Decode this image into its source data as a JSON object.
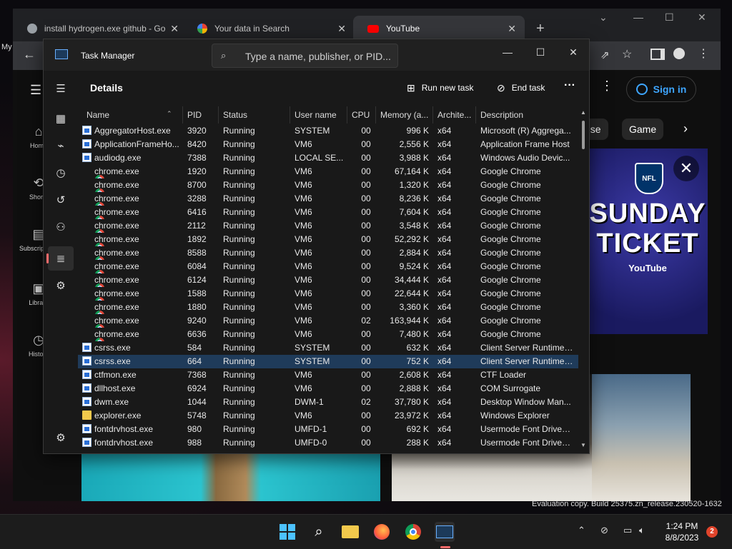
{
  "browser": {
    "tabs": [
      {
        "title": "install hydrogen.exe github - Go",
        "icon": "globe-icon"
      },
      {
        "title": "Your data in Search",
        "icon": "google-icon"
      },
      {
        "title": "YouTube",
        "icon": "youtube-icon"
      }
    ],
    "new_tab": "+",
    "left_overlay": "My"
  },
  "youtube": {
    "sign_in": "Sign in",
    "sidebar": [
      "Home",
      "Shorts",
      "Subscriptions",
      "Library",
      "History"
    ],
    "chips": [
      "use",
      "Game"
    ],
    "ad": {
      "brand": "NFL",
      "headline_1": "SUNDAY",
      "headline_2": "TICKET",
      "partner": "YouTube"
    }
  },
  "task_manager": {
    "window_title": "Task Manager",
    "search_placeholder": "Type a name, publisher, or PID...",
    "page_title": "Details",
    "run_new_task": "Run new task",
    "end_task": "End task",
    "columns": [
      "Name",
      "PID",
      "Status",
      "User name",
      "CPU",
      "Memory (a...",
      "Archite...",
      "Description"
    ],
    "rows": [
      {
        "name": "AggregatorHost.exe",
        "icon": "win",
        "pid": "3920",
        "status": "Running",
        "user": "SYSTEM",
        "cpu": "00",
        "mem": "996 K",
        "arch": "x64",
        "desc": "Microsoft (R) Aggrega..."
      },
      {
        "name": "ApplicationFrameHo...",
        "icon": "win",
        "pid": "8420",
        "status": "Running",
        "user": "VM6",
        "cpu": "00",
        "mem": "2,556 K",
        "arch": "x64",
        "desc": "Application Frame Host"
      },
      {
        "name": "audiodg.exe",
        "icon": "win",
        "pid": "7388",
        "status": "Running",
        "user": "LOCAL SE...",
        "cpu": "00",
        "mem": "3,988 K",
        "arch": "x64",
        "desc": "Windows Audio Devic..."
      },
      {
        "name": "chrome.exe",
        "icon": "chrome",
        "pid": "1920",
        "status": "Running",
        "user": "VM6",
        "cpu": "00",
        "mem": "67,164 K",
        "arch": "x64",
        "desc": "Google Chrome"
      },
      {
        "name": "chrome.exe",
        "icon": "chrome",
        "pid": "8700",
        "status": "Running",
        "user": "VM6",
        "cpu": "00",
        "mem": "1,320 K",
        "arch": "x64",
        "desc": "Google Chrome"
      },
      {
        "name": "chrome.exe",
        "icon": "chrome",
        "pid": "3288",
        "status": "Running",
        "user": "VM6",
        "cpu": "00",
        "mem": "8,236 K",
        "arch": "x64",
        "desc": "Google Chrome"
      },
      {
        "name": "chrome.exe",
        "icon": "chrome",
        "pid": "6416",
        "status": "Running",
        "user": "VM6",
        "cpu": "00",
        "mem": "7,604 K",
        "arch": "x64",
        "desc": "Google Chrome"
      },
      {
        "name": "chrome.exe",
        "icon": "chrome",
        "pid": "2112",
        "status": "Running",
        "user": "VM6",
        "cpu": "00",
        "mem": "3,548 K",
        "arch": "x64",
        "desc": "Google Chrome"
      },
      {
        "name": "chrome.exe",
        "icon": "chrome",
        "pid": "1892",
        "status": "Running",
        "user": "VM6",
        "cpu": "00",
        "mem": "52,292 K",
        "arch": "x64",
        "desc": "Google Chrome"
      },
      {
        "name": "chrome.exe",
        "icon": "chrome",
        "pid": "8588",
        "status": "Running",
        "user": "VM6",
        "cpu": "00",
        "mem": "2,884 K",
        "arch": "x64",
        "desc": "Google Chrome"
      },
      {
        "name": "chrome.exe",
        "icon": "chrome",
        "pid": "6084",
        "status": "Running",
        "user": "VM6",
        "cpu": "00",
        "mem": "9,524 K",
        "arch": "x64",
        "desc": "Google Chrome"
      },
      {
        "name": "chrome.exe",
        "icon": "chrome",
        "pid": "6124",
        "status": "Running",
        "user": "VM6",
        "cpu": "00",
        "mem": "34,444 K",
        "arch": "x64",
        "desc": "Google Chrome"
      },
      {
        "name": "chrome.exe",
        "icon": "chrome",
        "pid": "1588",
        "status": "Running",
        "user": "VM6",
        "cpu": "00",
        "mem": "22,644 K",
        "arch": "x64",
        "desc": "Google Chrome"
      },
      {
        "name": "chrome.exe",
        "icon": "chrome",
        "pid": "1880",
        "status": "Running",
        "user": "VM6",
        "cpu": "00",
        "mem": "3,360 K",
        "arch": "x64",
        "desc": "Google Chrome"
      },
      {
        "name": "chrome.exe",
        "icon": "chrome",
        "pid": "9240",
        "status": "Running",
        "user": "VM6",
        "cpu": "02",
        "mem": "163,944 K",
        "arch": "x64",
        "desc": "Google Chrome"
      },
      {
        "name": "chrome.exe",
        "icon": "chrome",
        "pid": "6636",
        "status": "Running",
        "user": "VM6",
        "cpu": "00",
        "mem": "7,480 K",
        "arch": "x64",
        "desc": "Google Chrome"
      },
      {
        "name": "csrss.exe",
        "icon": "win",
        "pid": "584",
        "status": "Running",
        "user": "SYSTEM",
        "cpu": "00",
        "mem": "632 K",
        "arch": "x64",
        "desc": "Client Server Runtime ..."
      },
      {
        "name": "csrss.exe",
        "icon": "win",
        "pid": "664",
        "status": "Running",
        "user": "SYSTEM",
        "cpu": "00",
        "mem": "752 K",
        "arch": "x64",
        "desc": "Client Server Runtime ...",
        "selected": true
      },
      {
        "name": "ctfmon.exe",
        "icon": "win",
        "pid": "7368",
        "status": "Running",
        "user": "VM6",
        "cpu": "00",
        "mem": "2,608 K",
        "arch": "x64",
        "desc": "CTF Loader"
      },
      {
        "name": "dllhost.exe",
        "icon": "win",
        "pid": "6924",
        "status": "Running",
        "user": "VM6",
        "cpu": "00",
        "mem": "2,888 K",
        "arch": "x64",
        "desc": "COM Surrogate"
      },
      {
        "name": "dwm.exe",
        "icon": "win",
        "pid": "1044",
        "status": "Running",
        "user": "DWM-1",
        "cpu": "02",
        "mem": "37,780 K",
        "arch": "x64",
        "desc": "Desktop Window Man..."
      },
      {
        "name": "explorer.exe",
        "icon": "folder",
        "pid": "5748",
        "status": "Running",
        "user": "VM6",
        "cpu": "00",
        "mem": "23,972 K",
        "arch": "x64",
        "desc": "Windows Explorer"
      },
      {
        "name": "fontdrvhost.exe",
        "icon": "win",
        "pid": "980",
        "status": "Running",
        "user": "UMFD-1",
        "cpu": "00",
        "mem": "692 K",
        "arch": "x64",
        "desc": "Usermode Font Driver ..."
      },
      {
        "name": "fontdrvhost.exe",
        "icon": "win",
        "pid": "988",
        "status": "Running",
        "user": "UMFD-0",
        "cpu": "00",
        "mem": "288 K",
        "arch": "x64",
        "desc": "Usermode Font Driver ..."
      }
    ]
  },
  "watermark": "Evaluation copy. Build 25375.zn_release.230520-1632",
  "taskbar": {
    "time": "1:24 PM",
    "date": "8/8/2023",
    "notifications": "2"
  }
}
